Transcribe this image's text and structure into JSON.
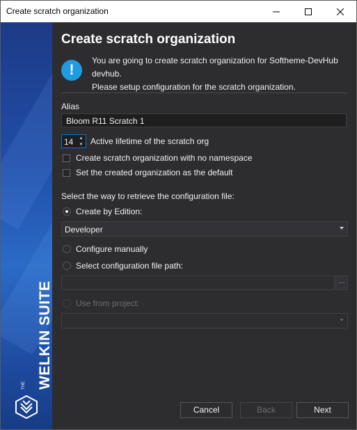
{
  "window": {
    "title": "Create scratch organization"
  },
  "brand": {
    "small": "THE",
    "name": "WELKIN SUITE"
  },
  "header": {
    "heading": "Create scratch organization",
    "info_line1": "You are going to create scratch organization for Softheme-DevHub",
    "info_line2": "devhub.",
    "info_line3": "Please setup configuration for the scratch organization."
  },
  "form": {
    "alias_label": "Alias",
    "alias_value": "Bloom R11 Scratch 1",
    "lifetime_value": "14",
    "lifetime_label": "Active lifetime of the scratch org",
    "no_namespace_label": "Create scratch organization with no namespace",
    "set_default_label": "Set the created organization as the default",
    "config_prompt": "Select the way to retrieve the configuration file:",
    "by_edition_label": "Create by Edition:",
    "edition_value": "Developer",
    "manual_label": "Configure manually",
    "file_path_label": "Select configuration file path:",
    "browse_label": "...",
    "from_project_label": "Use from project:"
  },
  "buttons": {
    "cancel": "Cancel",
    "back": "Back",
    "next": "Next"
  }
}
